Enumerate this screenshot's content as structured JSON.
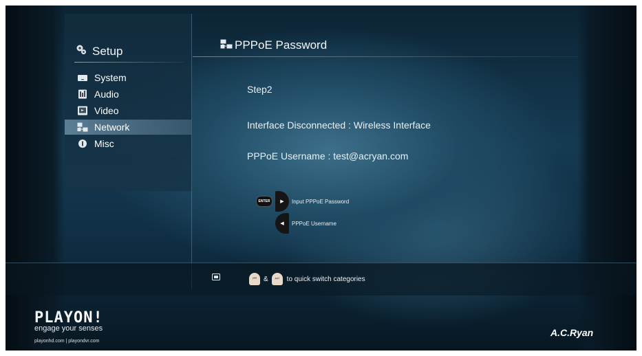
{
  "sidebar": {
    "title": "Setup",
    "items": [
      {
        "label": "System",
        "icon": "system-icon",
        "selected": false
      },
      {
        "label": "Audio",
        "icon": "audio-icon",
        "selected": false
      },
      {
        "label": "Video",
        "icon": "video-icon",
        "selected": false
      },
      {
        "label": "Network",
        "icon": "network-icon",
        "selected": true
      },
      {
        "label": "Misc",
        "icon": "misc-icon",
        "selected": false
      }
    ]
  },
  "main": {
    "title": "PPPoE Password",
    "step": "Step2",
    "interface_status": "Interface Disconnected : Wireless Interface",
    "username_line": "PPPoE Username : test@acryan.com"
  },
  "controls": {
    "enter_label": "ENTER",
    "right_hint": "Input PPPoE Password",
    "left_hint": "PPPoE Username"
  },
  "footer": {
    "ampersand": "&",
    "quick_switch": "to quick switch categories"
  },
  "brand": {
    "logo_part1": "PLAY",
    "logo_part2": "ON!",
    "tagline": "engage your senses",
    "sites": "playonhd.com | playondvr.com",
    "maker": "A.C.Ryan"
  },
  "colors": {
    "background": "#153a52",
    "selected_item": "#8fb4cc",
    "text": "#ffffff"
  }
}
